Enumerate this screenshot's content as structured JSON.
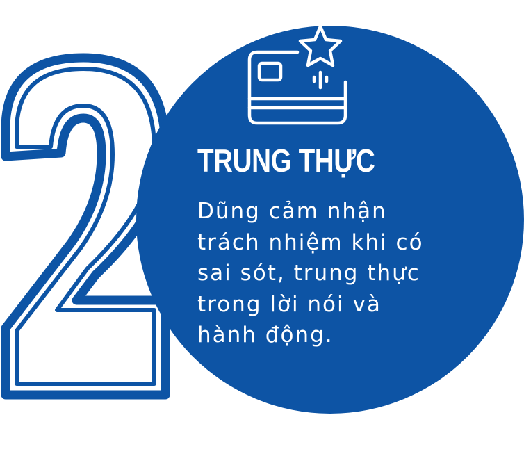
{
  "number": "2",
  "title": "TRUNG THỰC",
  "description_lines": [
    "Dũng cảm nhận",
    "trách nhiệm khi có",
    "sai sót, trung thực",
    "trong lời nói và",
    "hành động."
  ],
  "icon": "credit-card-star-icon",
  "colors": {
    "primary_blue": "#0d54a5",
    "text": "#ffffff",
    "background": "#ffffff"
  }
}
